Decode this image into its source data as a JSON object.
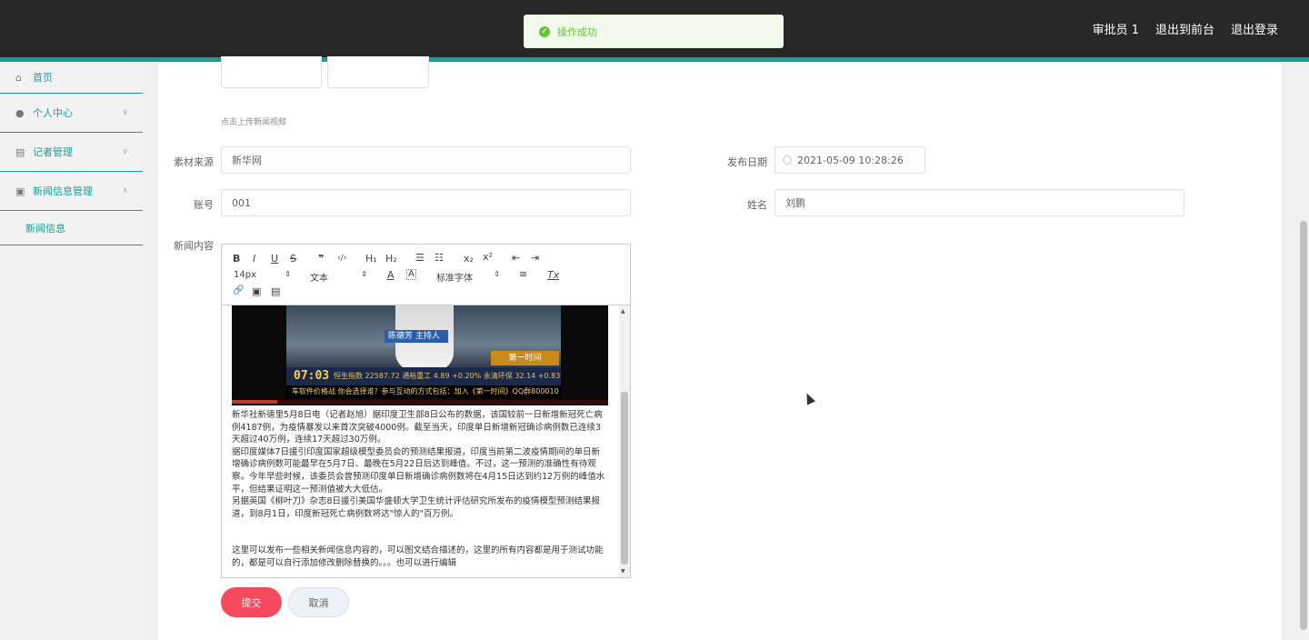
{
  "header": {
    "user": "审批员 1",
    "to_front": "退出到前台",
    "logout": "退出登录"
  },
  "toast": {
    "message": "操作成功",
    "color": "#67c23a"
  },
  "sidebar": {
    "accent_color": "#1a9e93",
    "items": [
      {
        "label": "首页",
        "icon": "home-icon"
      },
      {
        "label": "个人中心",
        "icon": "person-icon"
      },
      {
        "label": "记者管理",
        "icon": "reporter-icon"
      },
      {
        "label": "新闻信息管理",
        "icon": "news-icon"
      }
    ],
    "sub_items": [
      {
        "label": "新闻信息"
      }
    ]
  },
  "form": {
    "upload_hint": "点击上传新闻视频",
    "source_label": "素材来源",
    "source_value": "新华网",
    "publish_date_label": "发布日期",
    "publish_date_value": "2021-05-09 10:28:26",
    "account_label": "账号",
    "account_value": "001",
    "name_label": "姓名",
    "name_value": "刘鹏",
    "content_label": "新闻内容",
    "submit_label": "提交",
    "cancel_label": "取消"
  },
  "editor": {
    "toolbar": {
      "bold": "B",
      "italic": "I",
      "underline": "U",
      "strike": "S",
      "quote": "❞",
      "code": "‹/›",
      "h1": "H₁",
      "h2": "H₂",
      "ordered_list": "☰",
      "bullet_list": "☷",
      "subscript": "x₂",
      "superscript": "x²",
      "indent_left": "⇤",
      "indent_right": "⇥",
      "size": "14px",
      "header": "文本",
      "color": "A",
      "background": "A",
      "font": "标准字体",
      "align": "≡",
      "clean": "Tx",
      "link": "🔗",
      "image": "▣",
      "video": "▤"
    },
    "video_overlay": {
      "tag": "主持人",
      "tag_left": "陈德芳",
      "badge": "第一时间",
      "time": "07:03",
      "ticker": "恒生指数 22587.72 通裕重工 4.89 +0.20% 永清环保 32.14 +0.83%",
      "crawl": "车软件价格战 你会选择谁？参与互动的方式包括：加入《第一时间》QQ群800010",
      "progress": 0.12
    },
    "paragraphs": [
      "新华社新德里5月8日电（记者赵旭）据印度卫生部8日公布的数据，该国较前一日新增新冠死亡病例4187例，为疫情暴发以来首次突破4000例。截至当天，印度单日新增新冠确诊病例数已连续3天超过40万例，连续17天超过30万例。",
      "据印度媒体7日援引印度国家超级模型委员会的预测结果报道，印度当前第二波疫情期间的单日新增确诊病例数可能最早在5月7日、最晚在5月22日后达到峰值。不过，这一预测的准确性有待观察。今年早些时候，该委员会曾预测印度单日新增确诊病例数将在4月15日达到约12万例的峰值水平，但结果证明这一预测值被大大低估。",
      "另据英国《柳叶刀》杂志8日援引美国华盛顿大学卫生统计评估研究所发布的疫情模型预测结果报道，到8月1日，印度新冠死亡病例数将达\"惊人的\"百万例。"
    ],
    "note": "这里可以发布一些相关新闻信息内容的，可以图文结合描述的，这里的所有内容都是用于测试功能的，都是可以自行添加修改删除替换的。。。也可以进行编辑"
  },
  "colors": {
    "topbar": "#272727",
    "submit": "#f54a5e"
  }
}
